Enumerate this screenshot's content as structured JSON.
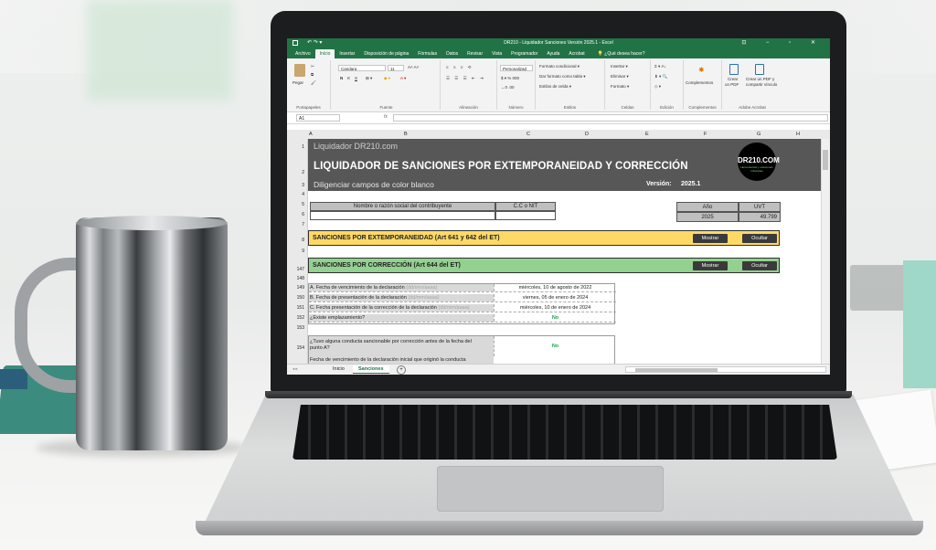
{
  "window": {
    "title": "DR210 - Liquidador Sanciones Versión 2025.1  -  Excel",
    "controls": "⊡ − ▫ ✕"
  },
  "tabs": [
    "Archivo",
    "Inicio",
    "Insertar",
    "Disposición de página",
    "Fórmulas",
    "Datos",
    "Revisar",
    "Vista",
    "Programador",
    "Ayuda",
    "Acrobat"
  ],
  "active_tab": "Inicio",
  "tell_me": "¿Qué desea hacer?",
  "ribbon": {
    "portapapeles": {
      "label": "Portapapeles",
      "paste": "Pegar"
    },
    "fuente": {
      "label": "Fuente",
      "font": "Candara",
      "size": "11",
      "bold": "N",
      "italic": "K",
      "underline": "S"
    },
    "alineacion": {
      "label": "Alineación"
    },
    "numero": {
      "label": "Número",
      "format": "Personalizad"
    },
    "estilos": {
      "label": "Estilos",
      "cond": "Formato condicional ▾",
      "table": "Dar formato como tabla ▾",
      "cell": "Estilos de celda ▾"
    },
    "celdas": {
      "label": "Celdas",
      "insert": "Insertar ▾",
      "delete": "Eliminar ▾",
      "format": "Formato ▾"
    },
    "edicion": {
      "label": "Edición"
    },
    "complementos": {
      "label": "Complementos",
      "btn": "Complementos"
    },
    "acrobat": {
      "label": "Adobe Acrobat",
      "create_pdf_1": "Crear",
      "create_pdf_2": "un PDF",
      "create_share_1": "Crear un PDF y",
      "create_share_2": "compartir vínculo"
    }
  },
  "formula_bar": {
    "cell": "A1",
    "fx": "fx",
    "content": ""
  },
  "columns": [
    "A",
    "B",
    "C",
    "D",
    "E",
    "F",
    "G",
    "H"
  ],
  "rows": [
    "1",
    "2",
    "3",
    "4",
    "5",
    "6",
    "7",
    "8",
    "9",
    "147",
    "148",
    "149",
    "150",
    "151",
    "152",
    "153",
    "154"
  ],
  "banner": {
    "subtitle": "Liquidador DR210.com",
    "title": "LIQUIDADOR DE SANCIONES POR EXTEMPORANEIDAD Y CORRECCIÓN",
    "hint": "Diligenciar campos de color blanco",
    "version_label": "Versión:",
    "version": "2025.1",
    "logo_main": "DR210.COM",
    "logo_sub": "Herramientas y soluciones tributarias"
  },
  "contrib": {
    "name_header": "Nombre o razón social del contribuyente",
    "nit_header": "C.C o NIT",
    "anio_header": "Año",
    "uvt_header": "UVT",
    "anio": "2025",
    "uvt": "49.799"
  },
  "sections": [
    {
      "label": "SANCIONES POR EXTEMPORANEIDAD (Art 641 y 642 del ET)",
      "color": "#ffd966",
      "show": "Mostrar",
      "hide": "Ocultar"
    },
    {
      "label": "SANCIONES POR CORRECCIÓN (Art 644 del ET)",
      "color": "#92d18f",
      "show": "Mostrar",
      "hide": "Ocultar"
    }
  ],
  "correction_rows": [
    {
      "label": "A. Fecha de vencimiento de la declaración",
      "hint": "(dd/mm/aaaa)",
      "value": "miércoles, 10 de agosto de 2022"
    },
    {
      "label": "B. Fecha de presentación de la declaración",
      "hint": "(dd/mm/aaaa)",
      "value": "viernes, 05 de enero de 2024"
    },
    {
      "label": "C. Fecha presentación de la corrección de la declaración",
      "hint": "(dd/mm/aaaa)",
      "value": "miércoles, 10 de enero de 2024"
    },
    {
      "label": "¿Existe emplazamiento?",
      "hint": "",
      "value": "No"
    }
  ],
  "question_154": {
    "line1": "¿Tuvo alguna conducta sancionable por corrección antes de la fecha del",
    "line2": "punto A?",
    "value": "No"
  },
  "row_155": "Fecha de vencimiento de la declaración inicial que originó la conducta",
  "sheet_tabs": [
    "Inicio",
    "Sanciones"
  ],
  "active_sheet": "Sanciones"
}
